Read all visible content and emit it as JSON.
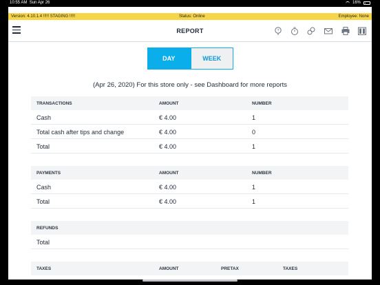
{
  "status_bar": {
    "time": "10:55 AM",
    "date": "Sun Apr 26",
    "battery": "16%"
  },
  "info_bar": {
    "version": "Version:  4.10.1.4 !!!!! STAGING !!!!!",
    "status": "Status:  Online",
    "employee": "Employee:  None"
  },
  "header": {
    "title": "REPORT",
    "icons": [
      "help-icon",
      "timer-icon",
      "link-icon",
      "mail-icon",
      "printer-icon",
      "cash-register-icon"
    ]
  },
  "segmented": {
    "day_label": "DAY",
    "week_label": "WEEK",
    "selected": "DAY"
  },
  "summary": "(Apr 26, 2020) For this store only - see Dashboard for more reports",
  "transactions": {
    "headers": [
      "TRANSACTIONS",
      "AMOUNT",
      "NUMBER"
    ],
    "rows": [
      {
        "label": "Cash",
        "amount": "€ 4.00",
        "number": "1"
      },
      {
        "label": "Total cash after tips and change",
        "amount": "€ 4.00",
        "number": "0"
      },
      {
        "label": "Total",
        "amount": "€ 4.00",
        "number": "1"
      }
    ]
  },
  "payments": {
    "headers": [
      "PAYMENTS",
      "AMOUNT",
      "NUMBER"
    ],
    "rows": [
      {
        "label": "Cash",
        "amount": "€ 4.00",
        "number": "1"
      },
      {
        "label": "Total",
        "amount": "€ 4.00",
        "number": "1"
      }
    ]
  },
  "refunds": {
    "headers": [
      "REFUNDS"
    ],
    "rows": [
      {
        "label": "Total"
      }
    ]
  },
  "taxes": {
    "headers": [
      "TAXES",
      "AMOUNT",
      "PRETAX",
      "TAXES"
    ]
  }
}
